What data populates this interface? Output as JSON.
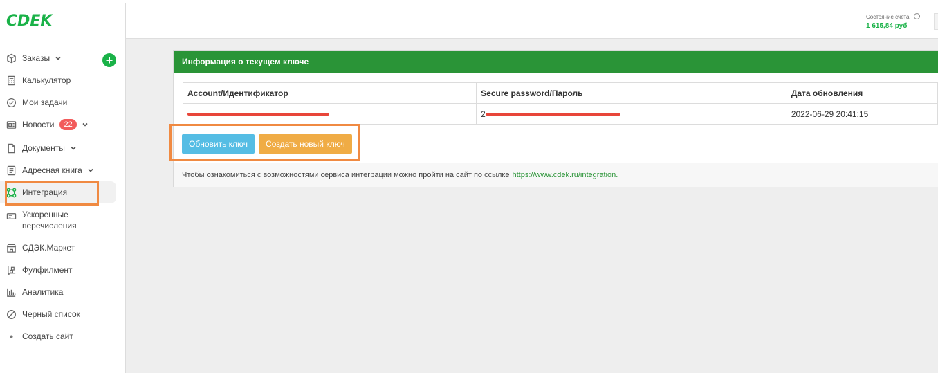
{
  "brand": {
    "logo_text": "CDEK",
    "accent": "#1ab248"
  },
  "header": {
    "account_label": "Состояние счета",
    "account_value": "1 615,84 руб"
  },
  "sidebar": {
    "items": [
      {
        "label": "Заказы",
        "icon": "box-icon",
        "has_dropdown": true
      },
      {
        "label": "Калькулятор",
        "icon": "calculator-icon"
      },
      {
        "label": "Мои задачи",
        "icon": "check-circle-icon"
      },
      {
        "label": "Новости",
        "icon": "news-icon",
        "badge": "22",
        "has_dropdown": true
      },
      {
        "label": "Документы",
        "icon": "document-icon",
        "has_dropdown": true
      },
      {
        "label": "Адресная книга",
        "icon": "address-book-icon",
        "has_dropdown": true
      },
      {
        "label": "Интеграция",
        "icon": "integration-icon",
        "active": true
      },
      {
        "label_line1": "Ускоренные",
        "label_line2": "перечисления",
        "icon": "payment-icon"
      },
      {
        "label": "СДЭК.Маркет",
        "icon": "store-icon"
      },
      {
        "label": "Фулфилмент",
        "icon": "fulfillment-icon"
      },
      {
        "label": "Аналитика",
        "icon": "analytics-icon"
      },
      {
        "label": "Черный список",
        "icon": "blocked-icon"
      },
      {
        "label": "Создать сайт",
        "icon": "dot-icon"
      }
    ]
  },
  "panel": {
    "title": "Информация о текущем ключе",
    "table": {
      "headers": [
        "Account/Идентификатор",
        "Secure password/Пароль",
        "Дата обновления"
      ],
      "rows": [
        {
          "account": "",
          "password_prefix": "2",
          "updated": "2022-06-29 20:41:15"
        }
      ]
    },
    "buttons": {
      "refresh": "Обновить ключ",
      "create": "Создать новый ключ"
    },
    "footer_text": "Чтобы ознакомиться с возможностями сервиса интеграции можно пройти на сайт по ссылке",
    "footer_link": "https://www.cdek.ru/integration."
  },
  "colors": {
    "panel_header": "#2a9437",
    "button_blue": "#55bde4",
    "button_orange": "#f0ac45",
    "highlight": "#f08a42",
    "badge": "#f25b5b"
  }
}
